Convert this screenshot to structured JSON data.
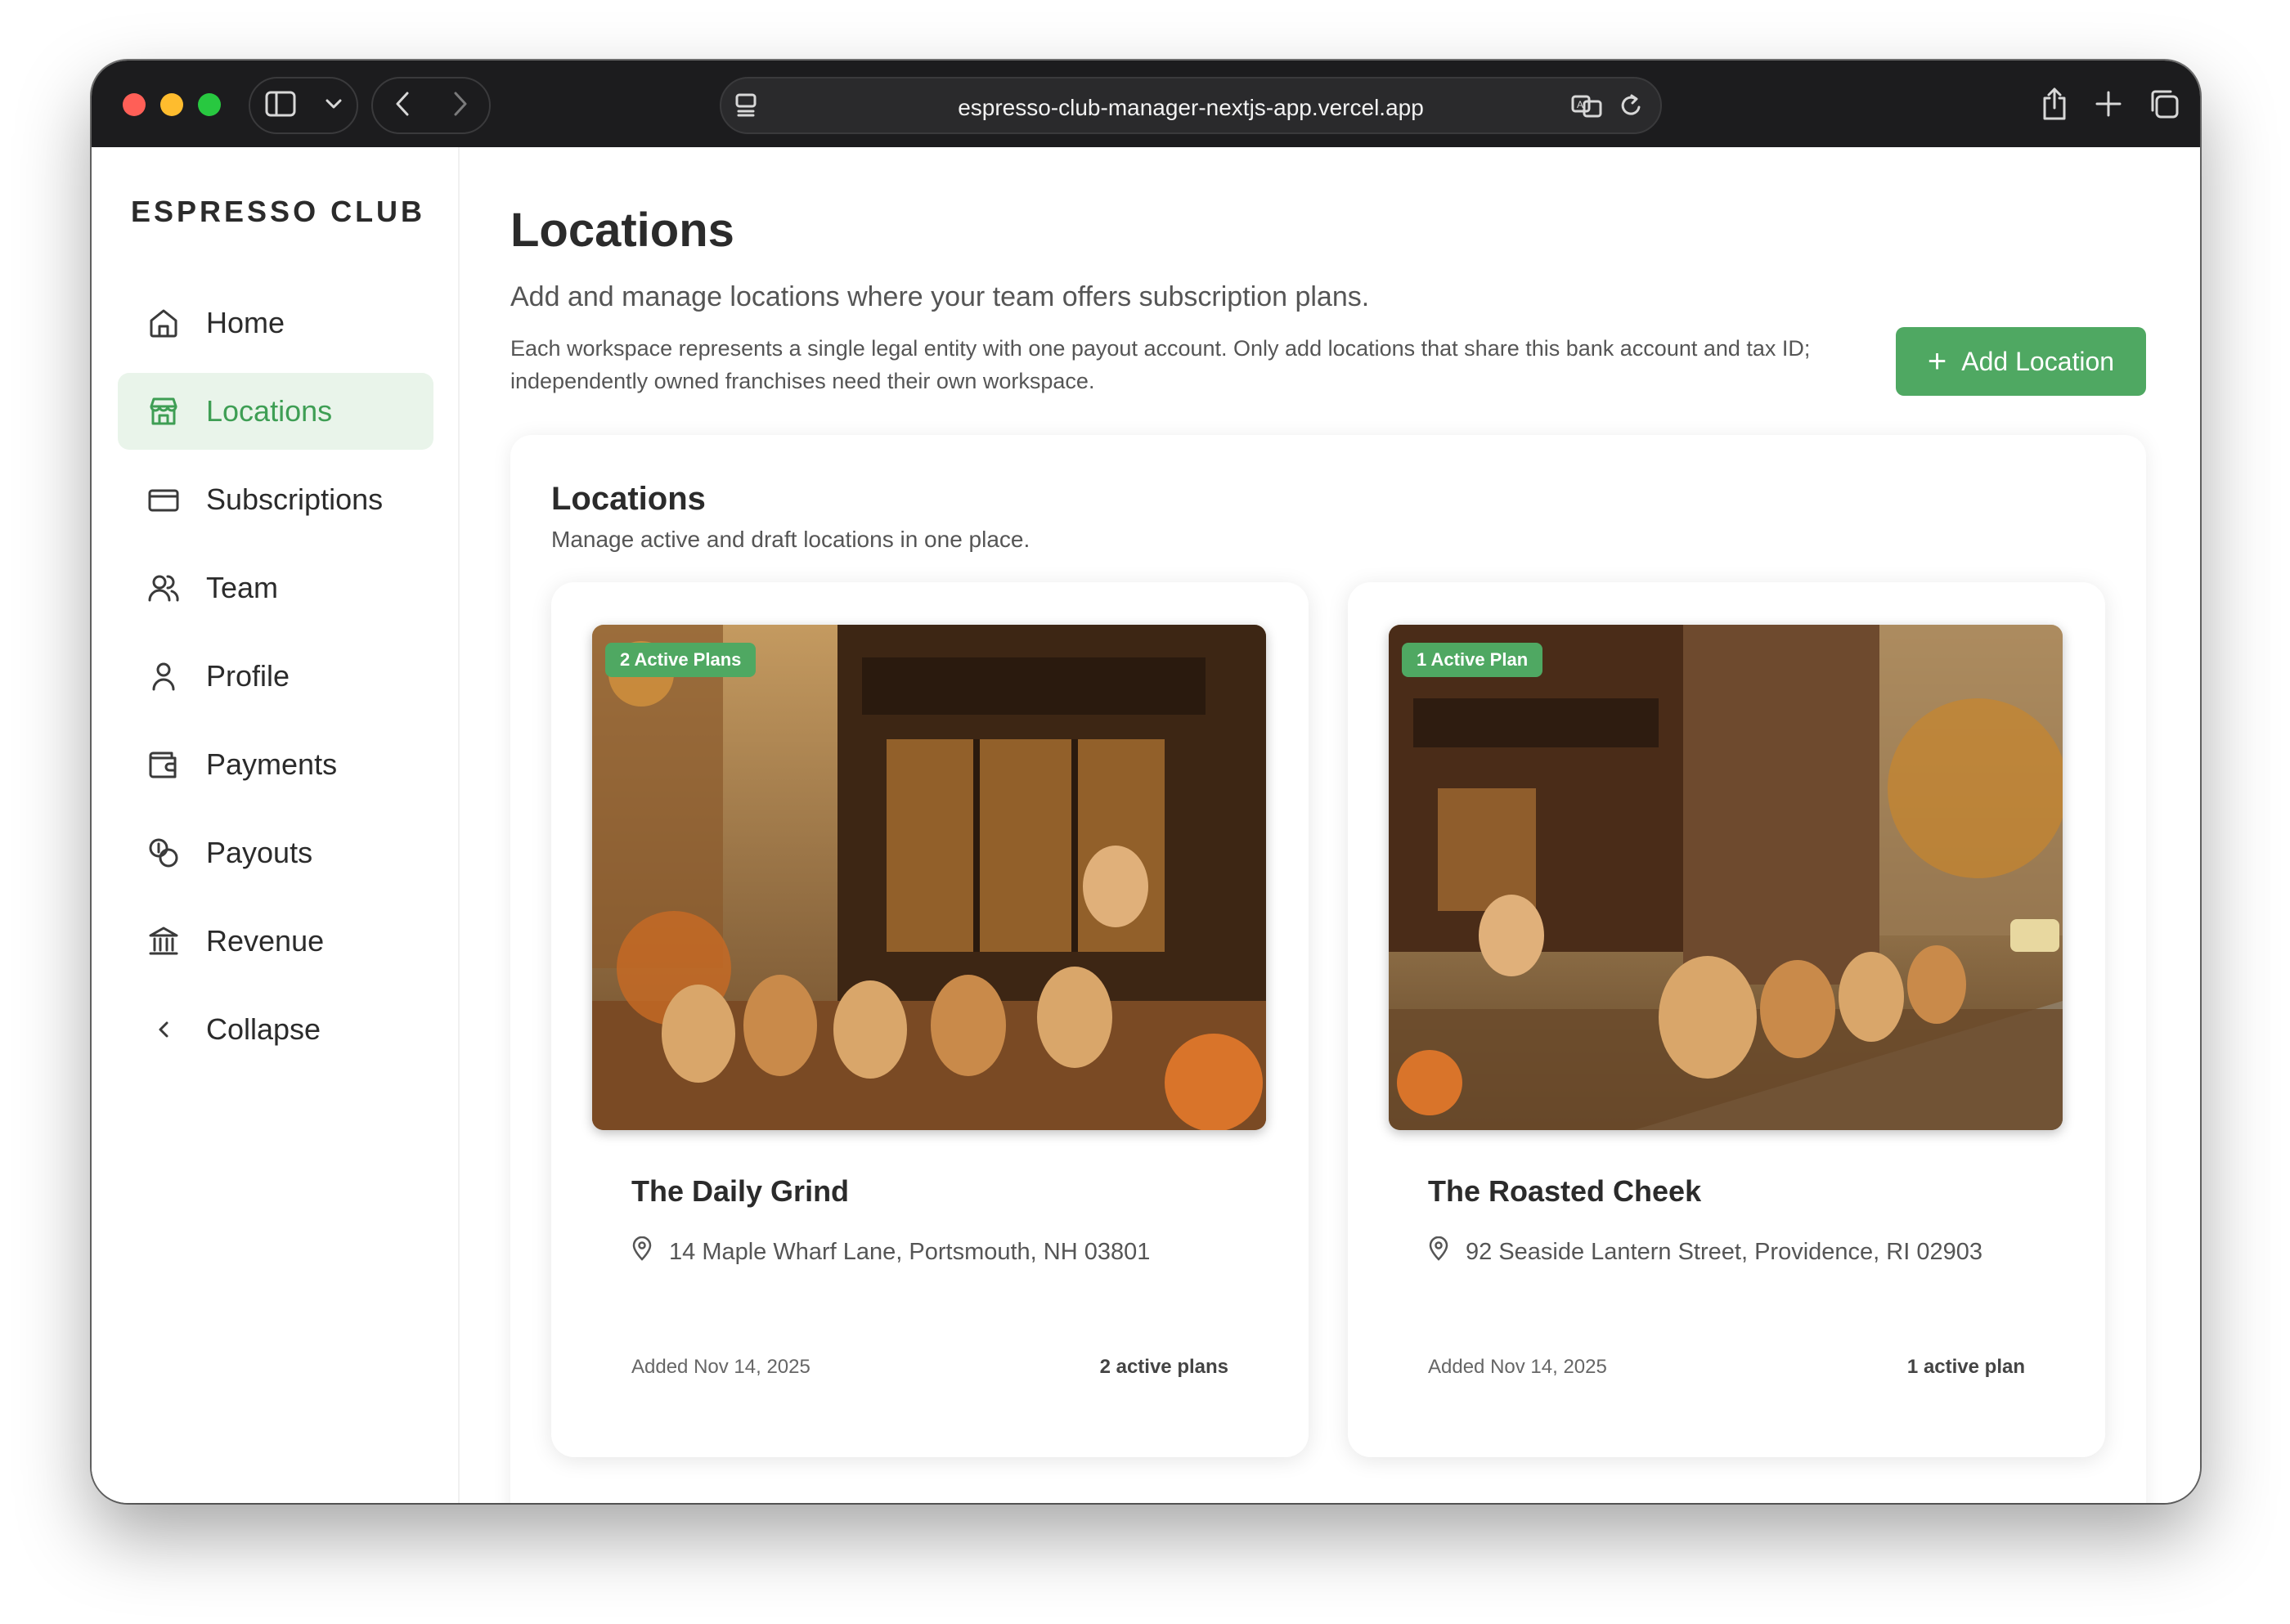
{
  "browser": {
    "url": "espresso-club-manager-nextjs-app.vercel.app"
  },
  "sidebar": {
    "brand": "ESPRESSO CLUB",
    "items": [
      {
        "label": "Home",
        "icon": "home-icon"
      },
      {
        "label": "Locations",
        "icon": "store-icon",
        "active": true
      },
      {
        "label": "Subscriptions",
        "icon": "card-icon"
      },
      {
        "label": "Team",
        "icon": "users-icon"
      },
      {
        "label": "Profile",
        "icon": "user-icon"
      },
      {
        "label": "Payments",
        "icon": "wallet-icon"
      },
      {
        "label": "Payouts",
        "icon": "coins-icon"
      },
      {
        "label": "Revenue",
        "icon": "bank-icon"
      },
      {
        "label": "Collapse",
        "icon": "chevron-left-icon"
      }
    ]
  },
  "header": {
    "title": "Locations",
    "subtitle": "Add and manage locations where your team offers subscription plans.",
    "note": "Each workspace represents a single legal entity with one payout account. Only add locations that share this bank account and tax ID; independently owned franchises need their own workspace.",
    "add_button": "Add Location"
  },
  "panel": {
    "title": "Locations",
    "subtitle": "Manage active and draft locations in one place."
  },
  "locations": [
    {
      "badge": "2 Active Plans",
      "name": "The Daily Grind",
      "address": "14 Maple Wharf Lane, Portsmouth, NH 03801",
      "added": "Added Nov 14, 2025",
      "plans": "2 active plans"
    },
    {
      "badge": "1 Active Plan",
      "name": "The Roasted Cheek",
      "address": "92 Seaside Lantern Street, Providence, RI 02903",
      "added": "Added Nov 14, 2025",
      "plans": "1 active plan"
    }
  ],
  "colors": {
    "accent": "#4fa862",
    "active_nav_bg": "#e9f4ea",
    "titlebar": "#1c1c1e"
  }
}
